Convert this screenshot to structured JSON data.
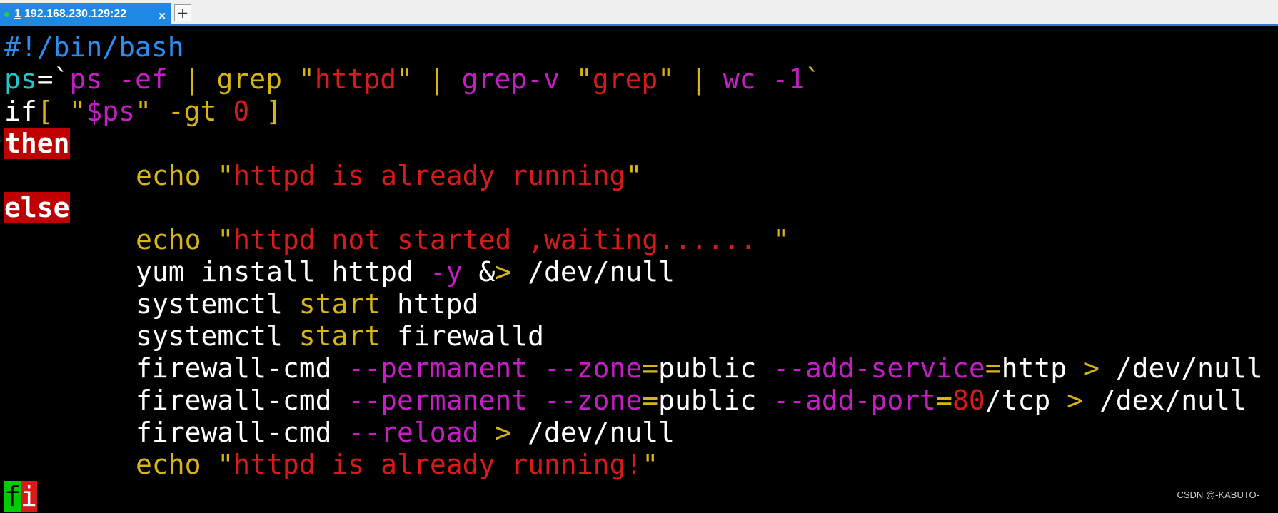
{
  "tab": {
    "number": "1",
    "label": "192.168.230.129:22",
    "close": "×",
    "add": "+"
  },
  "code": {
    "l1": "#!/bin/bash",
    "l2": {
      "a": "ps",
      "b": "=`",
      "c": "ps -ef",
      "d": " | ",
      "e": "grep",
      "f": " \"",
      "g": "httpd",
      "h": "\"",
      "i": " | ",
      "j": "grep-v",
      "k": " \"",
      "l": "grep",
      "m": "\"",
      "n": " | ",
      "o": "wc -1",
      "p": "`"
    },
    "l3": {
      "a": "if",
      "b": "[ ",
      "c": "\"",
      "d": "$ps",
      "e": "\"",
      "f": " -gt ",
      "g": "0",
      "h": " ]"
    },
    "l4": "then",
    "l5": {
      "a": "echo",
      "b": " \"",
      "c": "httpd is already running",
      "d": "\""
    },
    "l6": "else",
    "l7": {
      "a": "echo",
      "b": " \"",
      "c": "httpd not started ,waiting...... ",
      "d": "\""
    },
    "l8": {
      "a": "yum install httpd ",
      "b": "-y",
      "c": " &",
      "d": ">",
      "e": " /dev/null"
    },
    "l9": {
      "a": "systemctl ",
      "b": "start",
      "c": " httpd"
    },
    "l10": {
      "a": "systemctl ",
      "b": "start",
      "c": " firewalld"
    },
    "l11": {
      "a": "firewall-cmd ",
      "b": "--permanent --zone",
      "c": "=",
      "d": "public ",
      "e": "--add-service",
      "f": "=",
      "g": "http ",
      "h": ">",
      "i": " /dev/null"
    },
    "l12": {
      "a": "firewall-cmd ",
      "b": "--permanent --zone",
      "c": "=",
      "d": "public ",
      "e": "--add-port",
      "f": "=",
      "g": "80",
      "h": "/tcp ",
      "i": ">",
      "j": " /dex/null"
    },
    "l13": {
      "a": "firewall-cmd ",
      "b": "--reload",
      "c": " ",
      "d": ">",
      "e": " /dev/null"
    },
    "l14": {
      "a": "echo",
      "b": " \"",
      "c": "httpd is already running!",
      "d": "\""
    },
    "l15": {
      "a": "f",
      "b": "i"
    }
  },
  "watermark": "CSDN @-KABUTO-",
  "colors": {
    "background": "#000000",
    "tab_active": "#1e88e5",
    "keyword_highlight": "#c00000",
    "string_red": "#d71a1a",
    "option_magenta": "#c41ec4",
    "builtin_yellow": "#d7b515",
    "variable_cyan": "#1fc7c7",
    "shebang_blue": "#2d8cf0"
  }
}
